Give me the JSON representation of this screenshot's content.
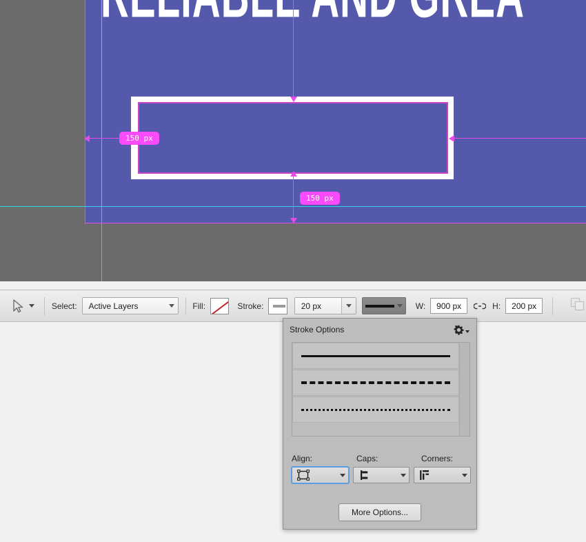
{
  "canvas": {
    "headline_text": "RELIABLE AND GREA",
    "artboard_color": "#5459ac",
    "workspace_color": "#6b6b6b",
    "shape_stroke_color": "#ffffff",
    "path_outline_color": "#cc44cc",
    "guide_cyan_color": "#2bd8e8",
    "guide_magenta_color": "#e84be8",
    "measure_badge_color": "#f94bf9",
    "measurements": [
      {
        "name": "left-distance",
        "value": "150 px"
      },
      {
        "name": "bottom-distance",
        "value": "150 px"
      }
    ]
  },
  "options_bar": {
    "tool_icon": "path-selection-arrow-icon",
    "tool_chevron": "chevron-down-icon",
    "select_label": "Select:",
    "select_value": "Active Layers",
    "select_chevron": "chevron-down-icon",
    "fill_label": "Fill:",
    "fill_swatch": "no-fill-swatch",
    "stroke_label": "Stroke:",
    "stroke_swatch": "stroke-color-swatch",
    "stroke_width_value": "20 px",
    "stroke_width_chevron": "chevron-down-icon",
    "stroke_style_icon": "solid-line-icon",
    "stroke_style_chevron": "chevron-down-icon",
    "width_label": "W:",
    "width_value": "900 px",
    "link_icon": "link-chain-icon",
    "height_label": "H:",
    "height_value": "200 px",
    "path_operations_icon": "path-operations-icon"
  },
  "stroke_options_panel": {
    "title": "Stroke Options",
    "gear_icon": "gear-icon",
    "gear_chevron": "triangle-down-icon",
    "presets": [
      {
        "name": "solid-line-preset",
        "style": "solid"
      },
      {
        "name": "dashed-line-preset",
        "style": "dashed"
      },
      {
        "name": "dotted-line-preset",
        "style": "dotted"
      }
    ],
    "align_label": "Align:",
    "align_icon": "align-center-stroke-icon",
    "align_chevron": "chevron-down-icon",
    "caps_label": "Caps:",
    "caps_icon": "butt-cap-icon",
    "caps_chevron": "chevron-down-icon",
    "corners_label": "Corners:",
    "corners_icon": "miter-corner-icon",
    "corners_chevron": "chevron-down-icon",
    "more_options_label": "More Options...",
    "focus_color": "#5b9fe0"
  }
}
